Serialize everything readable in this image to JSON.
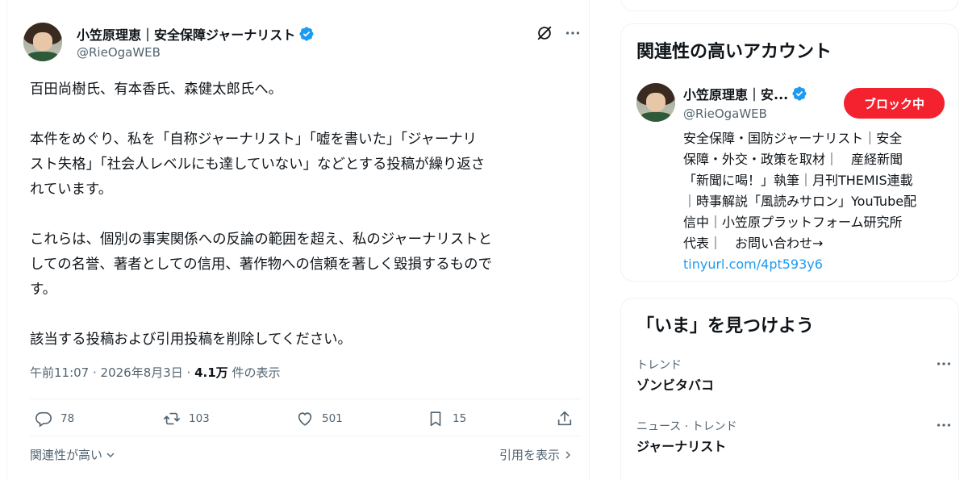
{
  "tweet": {
    "author_name": "小笠原理恵｜安全保障ジャーナリスト",
    "author_handle": "@RieOgaWEB",
    "paragraphs": [
      "百田尚樹氏、有本香氏、森健太郎氏へ。",
      "本件をめぐり、私を「自称ジャーナリスト」「嘘を書いた」「ジャーナリ\nスト失格」「社会人レベルにも達していない」などとする投稿が繰り返さ\nれています。",
      "これらは、個別の事実関係への反論の範囲を超え、私のジャーナリストと\nしての名誉、著者としての信用、著作物への信頼を著しく毀損するもので\nす。",
      "該当する投稿および引用投稿を削除してください。"
    ],
    "timestamp": "午前11:07 · 2026年8月3日 · ",
    "views_count": "4.1万",
    "views_label": " 件の表示",
    "replies": "78",
    "reposts": "103",
    "likes": "501",
    "bookmarks": "15",
    "sort_label": "関連性が高い",
    "quotes_label": "引用を表示"
  },
  "sidebar": {
    "relevant_title": "関連性の高いアカウント",
    "account": {
      "name": "小笠原理恵｜安...",
      "handle": "@RieOgaWEB",
      "button_label": "ブロック中",
      "bio": "安全保障・国防ジャーナリスト｜安全\n保障・外交・政策を取材｜　産経新聞\n「新聞に喝！」執筆｜月刊THEMIS連載\n｜時事解説「風読みサロン」YouTube配\n信中｜小笠原プラットフォーム研究所\n代表｜　お問い合わせ→",
      "link": "tinyurl.com/4pt593y6"
    },
    "now_title": "「いま」を見つけよう",
    "trends": [
      {
        "category": "トレンド",
        "name": "ゾンビタバコ"
      },
      {
        "category": "ニュース · トレンド",
        "name": "ジャーナリスト"
      }
    ]
  },
  "colors": {
    "accent": "#1d9bf0",
    "block_button": "#f4212e",
    "secondary_text": "#536471"
  }
}
